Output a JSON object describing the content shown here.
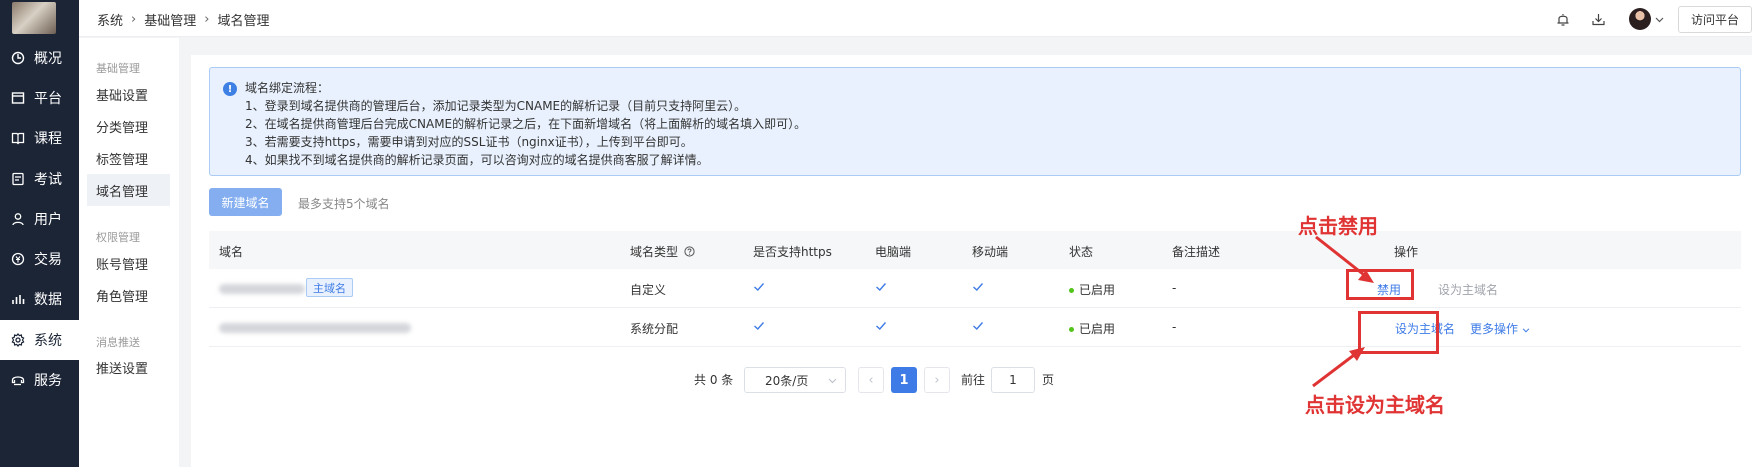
{
  "nav": {
    "items": [
      {
        "label": "概况",
        "icon": "dashboard-icon"
      },
      {
        "label": "平台",
        "icon": "platform-icon"
      },
      {
        "label": "课程",
        "icon": "book-icon"
      },
      {
        "label": "考试",
        "icon": "exam-icon"
      },
      {
        "label": "用户",
        "icon": "user-icon"
      },
      {
        "label": "交易",
        "icon": "currency-icon"
      },
      {
        "label": "数据",
        "icon": "bar-chart-icon"
      },
      {
        "label": "系统",
        "icon": "gear-icon"
      },
      {
        "label": "服务",
        "icon": "service-icon"
      }
    ],
    "active": "系统"
  },
  "header": {
    "breadcrumb": [
      "系统",
      "基础管理",
      "域名管理"
    ],
    "visit_label": "访问平台"
  },
  "submenu": {
    "groups": [
      {
        "title": "基础管理",
        "items": [
          "基础设置",
          "分类管理",
          "标签管理",
          "域名管理"
        ]
      },
      {
        "title": "权限管理",
        "items": [
          "账号管理",
          "角色管理"
        ]
      },
      {
        "title": "消息推送",
        "items": [
          "推送设置"
        ]
      }
    ],
    "active": "域名管理"
  },
  "alert": {
    "title": "域名绑定流程：",
    "lines": [
      "1、登录到域名提供商的管理后台，添加记录类型为CNAME的解析记录（目前只支持阿里云）。",
      "2、在域名提供商管理后台完成CNAME的解析记录之后，在下面新增域名（将上面解析的域名填入即可）。",
      "3、若需要支持https，需要申请到对应的SSL证书（nginx证书），上传到平台即可。",
      "4、如果找不到域名提供商的解析记录页面，可以咨询对应的域名提供商客服了解详情。"
    ]
  },
  "toolbar": {
    "new_label": "新建域名",
    "max_note": "最多支持5个域名"
  },
  "table": {
    "headers": [
      "域名",
      "域名类型",
      "是否支持https",
      "电脑端",
      "移动端",
      "状态",
      "备注描述",
      "操作"
    ],
    "rows": [
      {
        "tag": "主域名",
        "type": "自定义",
        "status": "已启用",
        "remark": "-",
        "actions": [
          "禁用",
          "设为主域名"
        ]
      },
      {
        "type": "系统分配",
        "status": "已启用",
        "remark": "-",
        "actions": [
          "设为主域名",
          "更多操作"
        ]
      }
    ]
  },
  "pagination": {
    "total_label": "共 0 条",
    "page_size": "20条/页",
    "current_page": "1",
    "goto_label": "前往",
    "goto_value": "1",
    "page_suffix": "页"
  },
  "annotations": {
    "disable_hint": "点击禁用",
    "primary_hint": "点击设为主域名",
    "color": "#e03333"
  },
  "colors": {
    "accent": "#3e7be6",
    "nav_bg": "#1c2536",
    "status_ok": "#52c41a"
  }
}
